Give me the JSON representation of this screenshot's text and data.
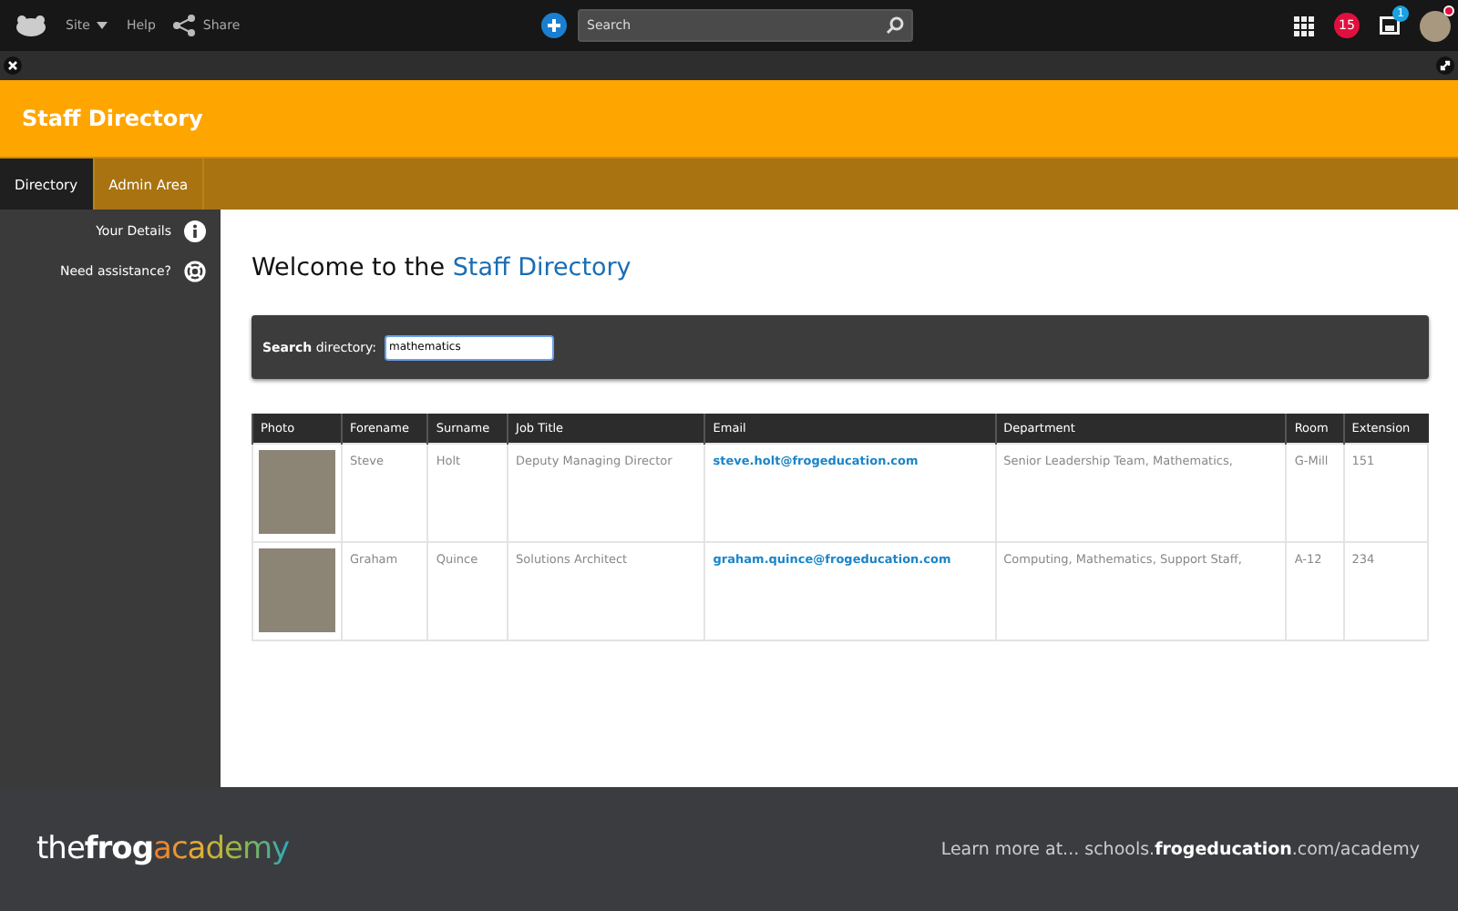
{
  "top_bar": {
    "nav": [
      {
        "label": "Site",
        "kind": "dropdown"
      },
      {
        "label": "Help",
        "kind": "link"
      },
      {
        "label": "Share",
        "kind": "share"
      }
    ],
    "search": {
      "placeholder": "Search"
    },
    "notifications": "15",
    "inbox_badge": "1",
    "avatar_alert": true
  },
  "header": {
    "title": "Staff Directory"
  },
  "tabs": [
    {
      "label": "Directory",
      "selected": true
    },
    {
      "label": "Admin Area",
      "selected": false
    }
  ],
  "sidebar": {
    "items": [
      {
        "label": "Your Details",
        "kind": "info"
      },
      {
        "label": "Need assistance?",
        "kind": "help"
      }
    ]
  },
  "main": {
    "heading": "Welcome to the ",
    "heading_highlight": "Staff Directory",
    "search": {
      "label": "**Search** directory:",
      "value": "mathematics"
    },
    "table": {
      "columns": [
        "Photo",
        "Forename",
        "Surname",
        "Job Title",
        "Email",
        "Department",
        "Room",
        "Extension"
      ],
      "rows": [
        {
          "forename": "Steve",
          "surname": "Holt",
          "job_title": "Deputy Managing Director",
          "email": "steve.holt@frogeducation.com",
          "department": "Senior Leadership Team, Mathematics,",
          "room": "G-Mill",
          "extension": "151"
        },
        {
          "forename": "Graham",
          "surname": "Quince",
          "job_title": "Solutions Architect",
          "email": "graham.quince@frogeducation.com",
          "department": "Computing, Mathematics, Support Staff,",
          "room": "A-12",
          "extension": "234"
        }
      ]
    }
  },
  "footer": {
    "logo": [
      "the",
      "frog",
      "academy"
    ],
    "link": "Learn more at... schools.**frogeducation**.com/academy"
  }
}
